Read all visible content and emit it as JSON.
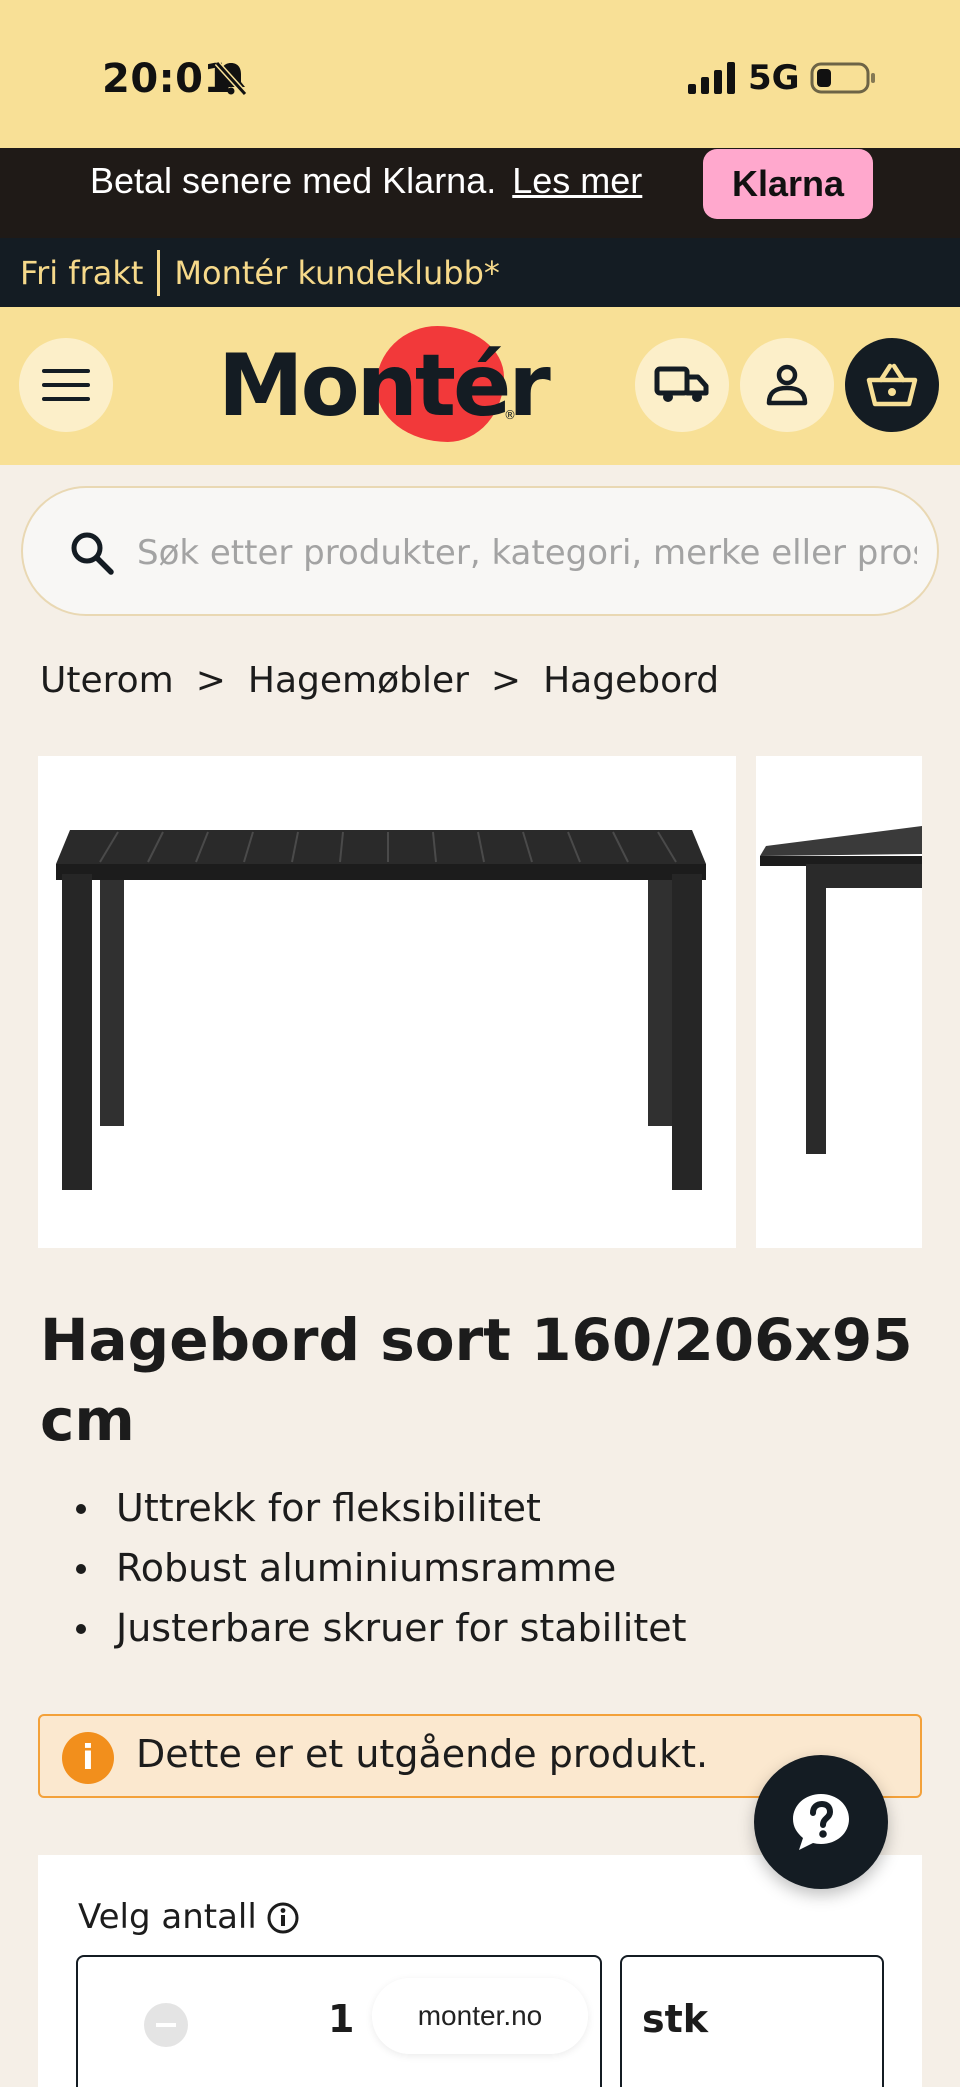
{
  "status_bar": {
    "time": "20:01",
    "network": "5G"
  },
  "klarna_banner": {
    "text": "Betal senere med Klarna.",
    "link": "Les mer",
    "badge": "Klarna"
  },
  "club_bar": {
    "free_shipping": "Fri frakt",
    "club": "Montér kundeklubb*"
  },
  "header": {
    "logo": "Montér"
  },
  "search": {
    "placeholder": "Søk etter produkter, kategori, merke eller prosjekt"
  },
  "breadcrumb": [
    {
      "label": "Uterom"
    },
    {
      "label": "Hagemøbler"
    },
    {
      "label": "Hagebord"
    }
  ],
  "breadcrumb_separator": ">",
  "product": {
    "title": "Hagebord sort 160/206x95 cm",
    "features": [
      "Uttrekk for fleksibilitet",
      "Robust aluminiumsramme",
      "Justerbare skruer for stabilitet"
    ]
  },
  "notice": {
    "icon": "i",
    "text": "Dette er et utgående produkt."
  },
  "quantity": {
    "label": "Velg antall",
    "value": "1",
    "unit": "stk"
  },
  "browser": {
    "url": "monter.no"
  },
  "colors": {
    "header_yellow": "#f8e096",
    "dark": "#141c23",
    "klarna_pink": "#ffa8cd",
    "logo_red": "#f2393a",
    "warning": "#f28f1c"
  }
}
